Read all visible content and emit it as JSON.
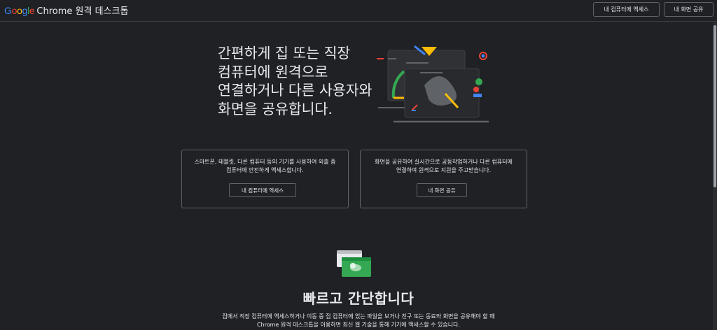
{
  "header": {
    "brand_letters": [
      "G",
      "o",
      "o",
      "g",
      "l",
      "e"
    ],
    "product": "Chrome 원격 데스크톱",
    "access_button": "내 컴퓨터에 액세스",
    "share_button": "내 화면 공유"
  },
  "hero": {
    "title": "간편하게 집 또는 직장 컴퓨터에 원격으로 연결하거나 다른 사용자와 화면을 공유합니다."
  },
  "cards": [
    {
      "text": "스마트폰, 태블릿, 다른 컴퓨터 등의 기기를 사용하여 외출 중 컴퓨터에 안전하게 액세스합니다.",
      "button": "내 컴퓨터에 액세스"
    },
    {
      "text": "화면을 공유하여 실시간으로 공동작업하거나 다른 컴퓨터에 연결하여 원격으로 지원을 주고받습니다.",
      "button": "내 화면 공유"
    }
  ],
  "feature": {
    "title": "빠르고 간단합니다",
    "text": "집에서 직장 컴퓨터에 액세스하거나 이동 중 집 컴퓨터에 있는 파일을 보거나 친구 또는 동료와 화면을 공유해야 할 때 Chrome 원격 데스크톱을 이용하면 최신 웹 기술을 통해 기기에 액세스할 수 있습니다."
  },
  "colors": {
    "background": "#202124",
    "border": "#5f6368",
    "text": "#e8eaed",
    "google_blue": "#4285f4",
    "google_red": "#ea4335",
    "google_yellow": "#fbbc05",
    "google_green": "#34a853"
  }
}
